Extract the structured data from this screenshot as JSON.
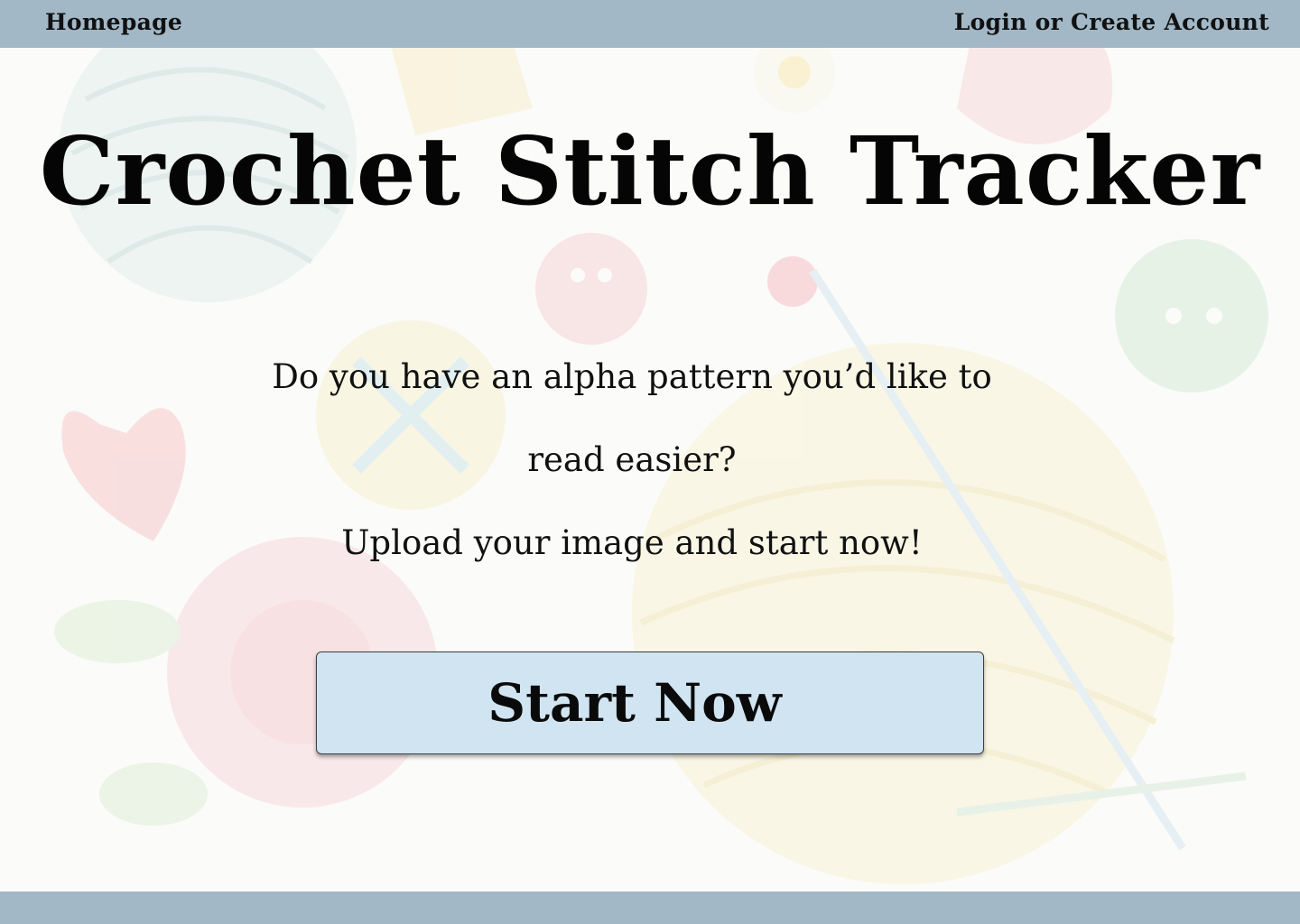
{
  "nav": {
    "home_label": "Homepage",
    "login_label": "Login or Create Account"
  },
  "hero": {
    "title": "Crochet Stitch Tracker",
    "intro_line1": "Do you have an alpha pattern you’d like to",
    "intro_line2": "read easier?",
    "intro_line3": "Upload your image and start now!",
    "cta_label": "Start Now"
  },
  "colors": {
    "bar": "#a2b8c6",
    "button_fill": "#d0e4f1",
    "background": "#fbfbf9"
  }
}
